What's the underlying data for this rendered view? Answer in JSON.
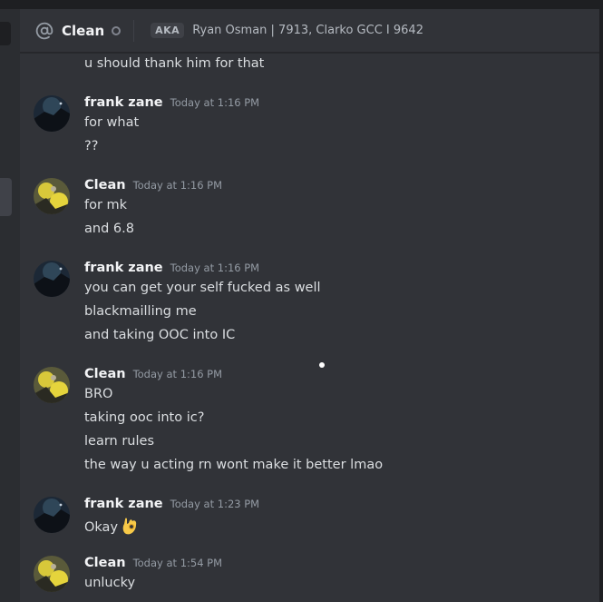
{
  "header": {
    "channel_name": "Clean",
    "aka_label": "AKA",
    "aka_names": "Ryan Osman | 7913, Clarko GCC I 9642"
  },
  "messages": {
    "m0_line1": "u should thank him for that",
    "m1_author": "frank zane",
    "m1_time": "Today at 1:16 PM",
    "m1_line1": "for what",
    "m1_line2": "??",
    "m2_author": "Clean",
    "m2_time": "Today at 1:16 PM",
    "m2_line1": "for mk",
    "m2_line2": "and 6.8",
    "m3_author": "frank zane",
    "m3_time": "Today at 1:16 PM",
    "m3_line1": "you can get your self fucked as well",
    "m3_line2": "blackmailling me",
    "m3_line3": "and taking OOC into IC",
    "m4_author": "Clean",
    "m4_time": "Today at 1:16 PM",
    "m4_line1": "BRO",
    "m4_line2": "taking ooc into ic?",
    "m4_line3": "learn rules",
    "m4_line4": "the way u acting rn wont make it better lmao",
    "m5_author": "frank zane",
    "m5_time": "Today at 1:23 PM",
    "m5_line1": "Okay",
    "m5_emoji": "ok-hand-emoji",
    "m6_author": "Clean",
    "m6_time": "Today at 1:54 PM",
    "m6_line1": "unlucky"
  },
  "colors": {
    "background": "#313338",
    "username": "#f2f3f5",
    "timestamp": "#949ba4",
    "text": "#dbdee1"
  }
}
